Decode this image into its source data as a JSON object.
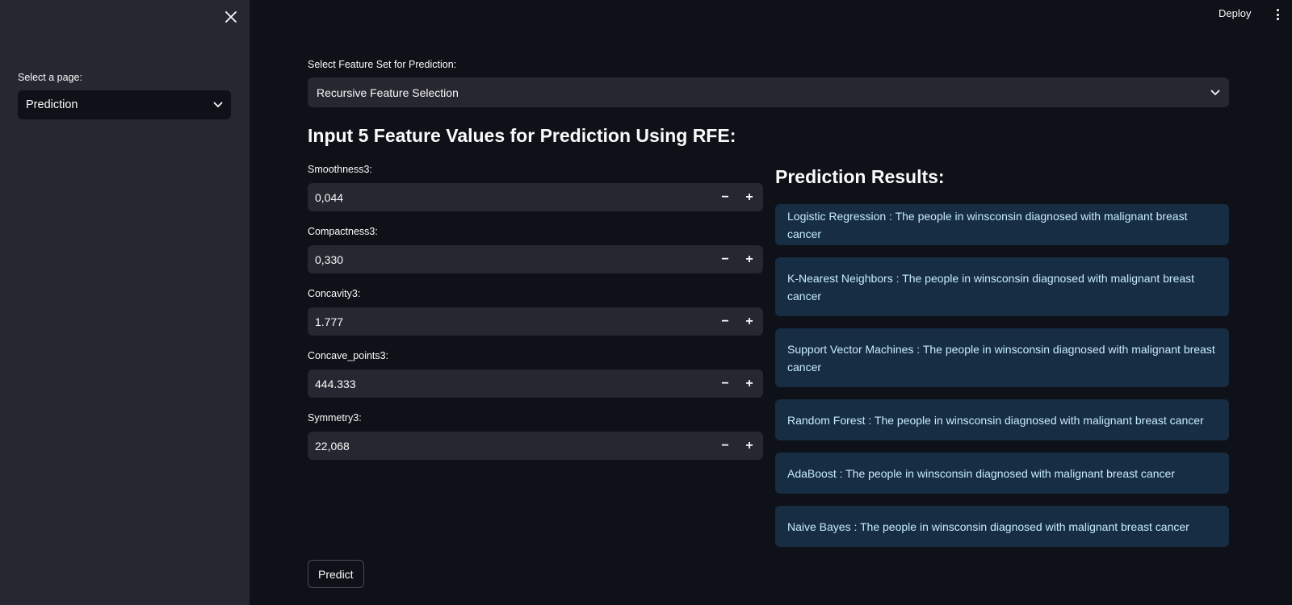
{
  "topbar": {
    "deploy_label": "Deploy",
    "menu_icon": "more-vertical-icon"
  },
  "sidebar": {
    "close_icon": "close-icon",
    "select_label": "Select a page:",
    "select_value": "Prediction"
  },
  "main": {
    "feature_set_label": "Select Feature Set for Prediction:",
    "feature_set_value": "Recursive Feature Selection",
    "heading": "Input 5 Feature Values for Prediction Using RFE:",
    "fields": [
      {
        "label": "Smoothness3:",
        "value": "0,044"
      },
      {
        "label": "Compactness3:",
        "value": "0,330"
      },
      {
        "label": "Concavity3:",
        "value": "1.777"
      },
      {
        "label": "Concave_points3:",
        "value": "444.333"
      },
      {
        "label": "Symmetry3:",
        "value": "22,068"
      }
    ],
    "stepper": {
      "minus": "−",
      "plus": "+"
    },
    "predict_label": "Predict"
  },
  "results": {
    "heading": "Prediction Results:",
    "items": [
      "Logistic Regression : The people in winsconsin diagnosed with malignant breast cancer",
      "K-Nearest Neighbors : The people in winsconsin diagnosed with malignant breast cancer",
      "Support Vector Machines : The people in winsconsin diagnosed with malignant breast cancer",
      "Random Forest : The people in winsconsin diagnosed with malignant breast cancer",
      "AdaBoost : The people in winsconsin diagnosed with malignant breast cancer",
      "Naive Bayes : The people in winsconsin diagnosed with malignant breast cancer"
    ]
  },
  "colors": {
    "background": "#0e1117",
    "sidebar": "#262730",
    "result_bg": "#172d43",
    "result_text": "#c7ebff"
  }
}
